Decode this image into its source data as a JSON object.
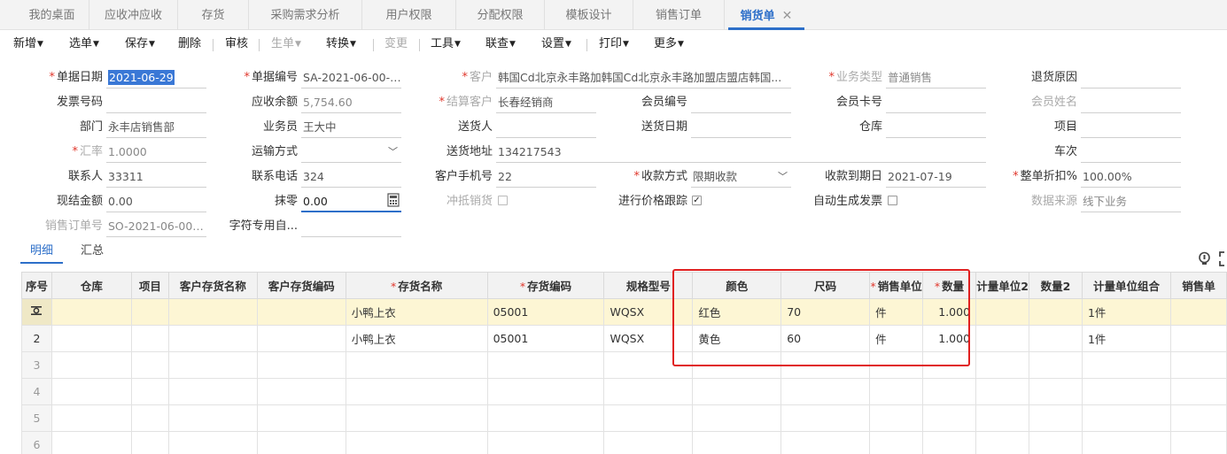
{
  "tabs": [
    {
      "label": "我的桌面"
    },
    {
      "label": "应收冲应收"
    },
    {
      "label": "存货"
    },
    {
      "label": "采购需求分析"
    },
    {
      "label": "用户权限"
    },
    {
      "label": "分配权限"
    },
    {
      "label": "模板设计"
    },
    {
      "label": "销售订单"
    },
    {
      "label": "销货单",
      "close": "✕"
    }
  ],
  "toolbar": {
    "new": "新增",
    "select": "选单",
    "save": "保存",
    "delete": "删除",
    "audit": "审核",
    "generate": "生单",
    "convert": "转换",
    "change": "变更",
    "tools": "工具",
    "linked": "联查",
    "settings": "设置",
    "print": "打印",
    "more": "更多"
  },
  "form": {
    "doc_date": {
      "label": "单据日期",
      "value": "2021-06-29"
    },
    "doc_no": {
      "label": "单据编号",
      "value": "SA-2021-06-00-0..."
    },
    "customer": {
      "label": "客户",
      "value": "韩国Cd北京永丰路加韩国Cd北京永丰路加盟店盟店韩国..."
    },
    "biz_type": {
      "label": "业务类型",
      "value": "普通销售"
    },
    "return_reason": {
      "label": "退货原因",
      "value": ""
    },
    "invoice_no": {
      "label": "发票号码",
      "value": ""
    },
    "ar_balance": {
      "label": "应收余额",
      "value": "5,754.60"
    },
    "settle_customer": {
      "label": "结算客户",
      "value": "长春经销商"
    },
    "member_no": {
      "label": "会员编号",
      "value": ""
    },
    "member_card": {
      "label": "会员卡号",
      "value": ""
    },
    "member_name": {
      "label": "会员姓名",
      "value": ""
    },
    "dept": {
      "label": "部门",
      "value": "永丰店销售部"
    },
    "salesman": {
      "label": "业务员",
      "value": "王大中"
    },
    "deliverer": {
      "label": "送货人",
      "value": ""
    },
    "delivery_date": {
      "label": "送货日期",
      "value": ""
    },
    "warehouse": {
      "label": "仓库",
      "value": ""
    },
    "project": {
      "label": "项目",
      "value": ""
    },
    "rate": {
      "label": "汇率",
      "value": "1.0000"
    },
    "transport": {
      "label": "运输方式",
      "value": ""
    },
    "delivery_addr": {
      "label": "送货地址",
      "value": "134217543"
    },
    "trip": {
      "label": "车次",
      "value": ""
    },
    "contact": {
      "label": "联系人",
      "value": "33311"
    },
    "phone": {
      "label": "联系电话",
      "value": "324"
    },
    "mobile": {
      "label": "客户手机号",
      "value": "22"
    },
    "pay_method": {
      "label": "收款方式",
      "value": "限期收款"
    },
    "due_date": {
      "label": "收款到期日",
      "value": "2021-07-19"
    },
    "discount": {
      "label": "整单折扣%",
      "value": "100.00%"
    },
    "cash_amount": {
      "label": "现结金额",
      "value": "0.00"
    },
    "rounding": {
      "label": "抹零",
      "value": "0.00"
    },
    "offset_sales": {
      "label": "冲抵销货"
    },
    "price_track": {
      "label": "进行价格跟踪"
    },
    "auto_invoice": {
      "label": "自动生成发票"
    },
    "data_source": {
      "label": "数据来源",
      "value": "线下业务"
    },
    "so_no": {
      "label": "销售订单号",
      "value": "SO-2021-06-00-..."
    },
    "char_custom": {
      "label": "字符专用自...",
      "value": ""
    }
  },
  "detail_tabs": [
    "明细",
    "汇总"
  ],
  "grid": {
    "columns": [
      "序号",
      "仓库",
      "项目",
      "客户存货名称",
      "客户存货编码",
      "存货名称",
      "存货编码",
      "规格型号",
      "颜色",
      "尺码",
      "销售单位",
      "数量",
      "计量单位2",
      "数量2",
      "计量单位组合",
      "销售单"
    ],
    "rows": [
      {
        "idx": "",
        "item_name": "小鸭上衣",
        "item_code": "05001",
        "spec": "WQSX",
        "color": "红色",
        "size": "70",
        "unit": "件",
        "qty": "1.000",
        "unit_combo": "1件"
      },
      {
        "idx": "2",
        "item_name": "小鸭上衣",
        "item_code": "05001",
        "spec": "WQSX",
        "color": "黄色",
        "size": "60",
        "unit": "件",
        "qty": "1.000",
        "unit_combo": "1件"
      },
      {
        "idx": "3"
      },
      {
        "idx": "4"
      },
      {
        "idx": "5"
      },
      {
        "idx": "6"
      }
    ]
  }
}
